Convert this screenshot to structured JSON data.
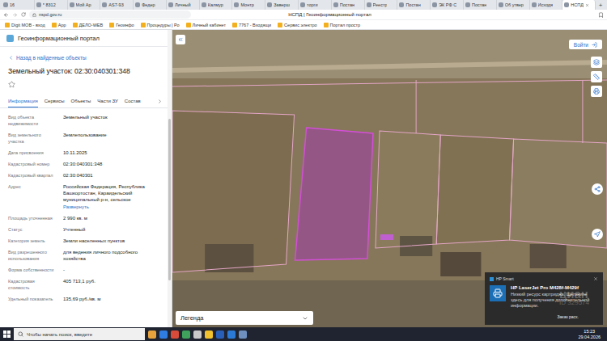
{
  "browser": {
    "tabs": [
      {
        "label": "16",
        "selected": false
      },
      {
        "label": "* 8312",
        "selected": false
      },
      {
        "label": "Мой Ар",
        "selected": false
      },
      {
        "label": "AS7-93",
        "selected": false
      },
      {
        "label": "Федер",
        "selected": false
      },
      {
        "label": "Личный",
        "selected": false
      },
      {
        "label": "Калмур",
        "selected": false
      },
      {
        "label": "Монтр",
        "selected": false
      },
      {
        "label": "Заверш",
        "selected": false
      },
      {
        "label": "торги",
        "selected": false
      },
      {
        "label": "Постан",
        "selected": false
      },
      {
        "label": "Реестр",
        "selected": false
      },
      {
        "label": "Постан",
        "selected": false
      },
      {
        "label": "ЭК РФ С",
        "selected": false
      },
      {
        "label": "Постан",
        "selected": false
      },
      {
        "label": "Об утвер",
        "selected": false
      },
      {
        "label": "Исходя",
        "selected": false
      },
      {
        "label": "НСПД",
        "selected": true
      }
    ],
    "new_tab": "+",
    "url": "nspd.gov.ru",
    "page_title": "НСПД | Геоинформационный портал",
    "bookmarks": [
      "Digit МОВ - вход",
      "App",
      "ДЕЛО-WEB",
      "Геоинфо",
      "Процедуры | Ро",
      "Личный кабинет",
      "7767 - Входящи",
      "Сервис электро",
      "Портал простр"
    ]
  },
  "panel": {
    "portal_title": "Геоинформационный портал",
    "back_link": "Назад в найденные объекты",
    "object_title": "Земельный участок: 02:30:040301:348",
    "favorite": false,
    "tabs": [
      {
        "label": "Информация",
        "selected": true
      },
      {
        "label": "Сервисы",
        "selected": false
      },
      {
        "label": "Объекты",
        "selected": false
      },
      {
        "label": "Части ЗУ",
        "selected": false
      },
      {
        "label": "Состав",
        "selected": false
      }
    ],
    "properties": [
      {
        "label": "Вид объекта недвижимости",
        "value": "Земельный участок"
      },
      {
        "label": "Вид земельного участка",
        "value": "Землепользование"
      },
      {
        "label": "Дата присвоения",
        "value": "10.11.2025"
      },
      {
        "label": "Кадастровый номер",
        "value": "02:30:040301:348"
      },
      {
        "label": "Кадастровый квартал",
        "value": "02:30:040301"
      },
      {
        "label": "Адрес",
        "value": "Российская Федерация, Республика Башкортостан, Караидельский муниципальный р-н, сельское",
        "link": "Развернуть"
      },
      {
        "label": "Площадь уточненная",
        "value": "2 990 кв. м"
      },
      {
        "label": "Статус",
        "value": "Учтенный"
      },
      {
        "label": "Категория земель",
        "value": "Земли населенных пунктов"
      },
      {
        "label": "Вид разрешенного использования",
        "value": "для ведения личного подсобного хозяйства"
      },
      {
        "label": "Форма собственности",
        "value": "-"
      },
      {
        "label": "Кадастровая стоимость",
        "value": "405 713,1 руб."
      },
      {
        "label": "Удельный показатель",
        "value": "135,69 руб./кв. м"
      }
    ]
  },
  "map": {
    "login_button": "Войти",
    "legend": "Легенда"
  },
  "notification": {
    "app": "HP Smart",
    "title": "HP LaserJet Pro M428f-M429f",
    "message": "Низкий ресурс картриджа. Щелкните здесь для получения дополнительной информации.",
    "action": "Заказ расх."
  },
  "watermark": {
    "brand": "циан",
    "id": "ID 329574"
  },
  "taskbar": {
    "search_placeholder": "Чтобы начать поиск, введите",
    "time": "15:23",
    "date": "29.04.2026"
  }
}
